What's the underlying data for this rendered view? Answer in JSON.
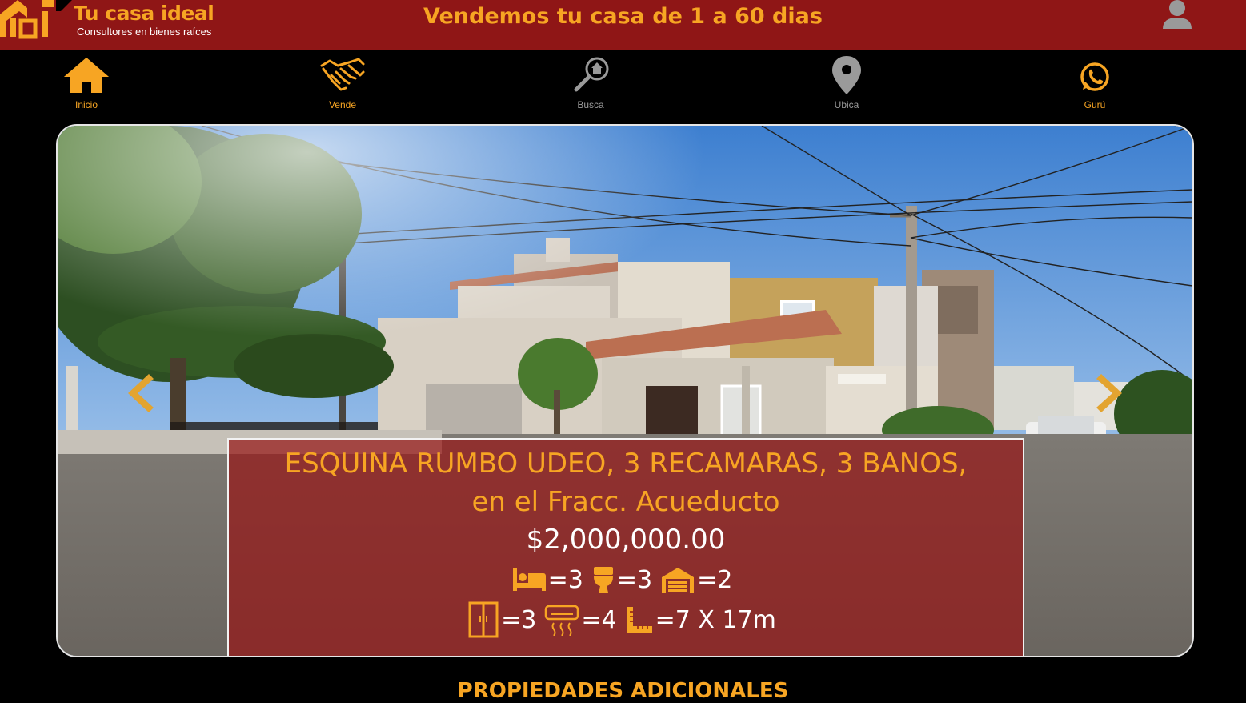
{
  "header": {
    "logo_mark": "TCI",
    "brand_name": "Tu casa ideal",
    "brand_tagline": "Consultores en bienes raíces",
    "headline": "Vendemos tu casa de 1 a 60 dias",
    "user_icon": "user-icon"
  },
  "nav": {
    "items": [
      {
        "label": "Inicio",
        "icon": "home-icon",
        "active": true
      },
      {
        "label": "Vende",
        "icon": "handshake-icon",
        "active": true
      },
      {
        "label": "Busca",
        "icon": "search-house-icon",
        "active": false
      },
      {
        "label": "Ubica",
        "icon": "map-pin-icon",
        "active": false
      },
      {
        "label": "Gurú",
        "icon": "whatsapp-icon",
        "active": true
      }
    ]
  },
  "listing": {
    "title_line1": "ESQUINA RUMBO UDEO, 3 RECAMARAS, 3 BANOS,",
    "title_line2": "en el Fracc. Acueducto",
    "price": "$2,000,000.00",
    "features": {
      "bedrooms": "=3",
      "bathrooms": "=3",
      "garage": "=2",
      "closets": "=3",
      "air_conditioners": "=4",
      "lot_size": "=7 X 17m"
    }
  },
  "section": {
    "title": "PROPIEDADES ADICIONALES"
  },
  "colors": {
    "header_bg": "#8f1616",
    "accent": "#f7a523",
    "caption_bg": "rgba(150,22,22,0.72)",
    "page_bg": "#000000"
  }
}
